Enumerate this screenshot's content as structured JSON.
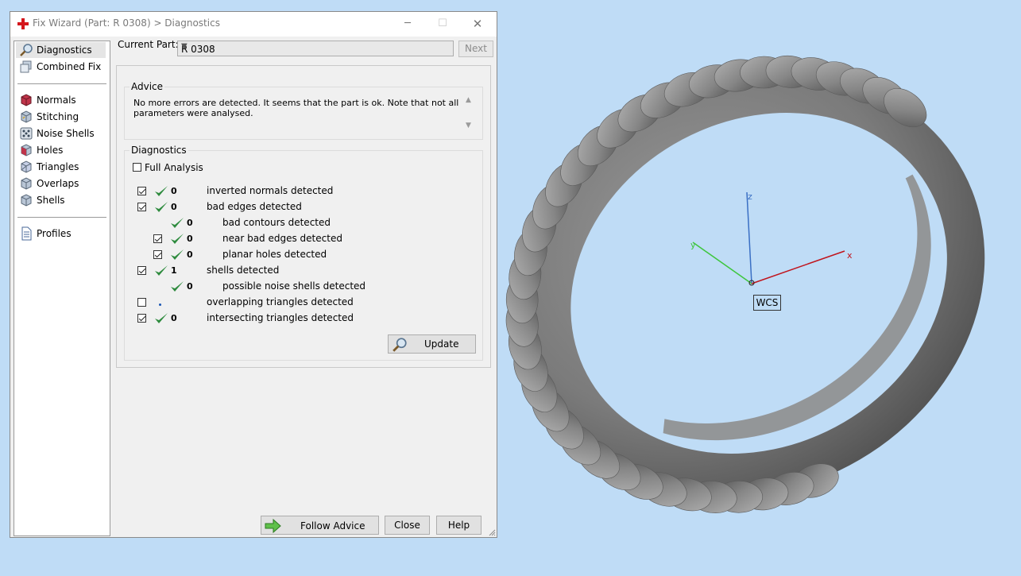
{
  "window": {
    "title": "Fix Wizard (Part: R 0308) > Diagnostics",
    "minimize_glyph": "─",
    "maximize_glyph": "☐",
    "close_glyph": "✕"
  },
  "sidebar": {
    "items": [
      {
        "label": "Diagnostics",
        "icon": "magnifier-icon",
        "selected": true
      },
      {
        "label": "Combined Fix",
        "icon": "cubes-icon"
      },
      {
        "label": "Normals",
        "icon": "cube-icon"
      },
      {
        "label": "Stitching",
        "icon": "cube-icon"
      },
      {
        "label": "Noise Shells",
        "icon": "dice-icon"
      },
      {
        "label": "Holes",
        "icon": "cube-icon"
      },
      {
        "label": "Triangles",
        "icon": "cube-icon"
      },
      {
        "label": "Overlaps",
        "icon": "cube-icon"
      },
      {
        "label": "Shells",
        "icon": "cube-icon"
      },
      {
        "label": "Profiles",
        "icon": "document-icon"
      }
    ]
  },
  "current_part": {
    "label": "Current Part:",
    "value": "R 0308",
    "next_label": "Next"
  },
  "advice": {
    "title": "Advice",
    "text": "No more errors are detected. It seems that the part is ok. Note that not all parameters were analysed."
  },
  "diagnostics": {
    "title": "Diagnostics",
    "full_analysis_label": "Full Analysis",
    "full_analysis_checked": false,
    "rows": [
      {
        "checked": true,
        "status": "ok",
        "count": "0",
        "text": "inverted normals detected"
      },
      {
        "checked": true,
        "status": "ok",
        "count": "0",
        "text": "bad edges detected"
      },
      {
        "checked": null,
        "status": "ok",
        "count": "0",
        "text": "bad contours detected"
      },
      {
        "checked": true,
        "status": "ok",
        "count": "0",
        "text": "near bad edges detected"
      },
      {
        "checked": true,
        "status": "ok",
        "count": "0",
        "text": "planar holes detected"
      },
      {
        "checked": true,
        "status": "ok",
        "count": "1",
        "text": "shells detected"
      },
      {
        "checked": null,
        "status": "ok",
        "count": "0",
        "text": "possible noise shells detected"
      },
      {
        "checked": false,
        "status": "skipped",
        "count": "",
        "text": "overlapping triangles detected"
      },
      {
        "checked": true,
        "status": "ok",
        "count": "0",
        "text": "intersecting triangles detected"
      }
    ],
    "update_label": "Update"
  },
  "footer": {
    "follow_advice_label": "Follow Advice",
    "close_label": "Close",
    "help_label": "Help"
  },
  "viewport": {
    "axis_x": "x",
    "axis_y": "y",
    "axis_z": "z",
    "wcs_label": "WCS"
  },
  "colors": {
    "check_green": "#2e8b3e",
    "axis_x": "#c0141c",
    "axis_y": "#3ec63e",
    "axis_z": "#3a6fc4",
    "background": "#bfdcf6"
  }
}
